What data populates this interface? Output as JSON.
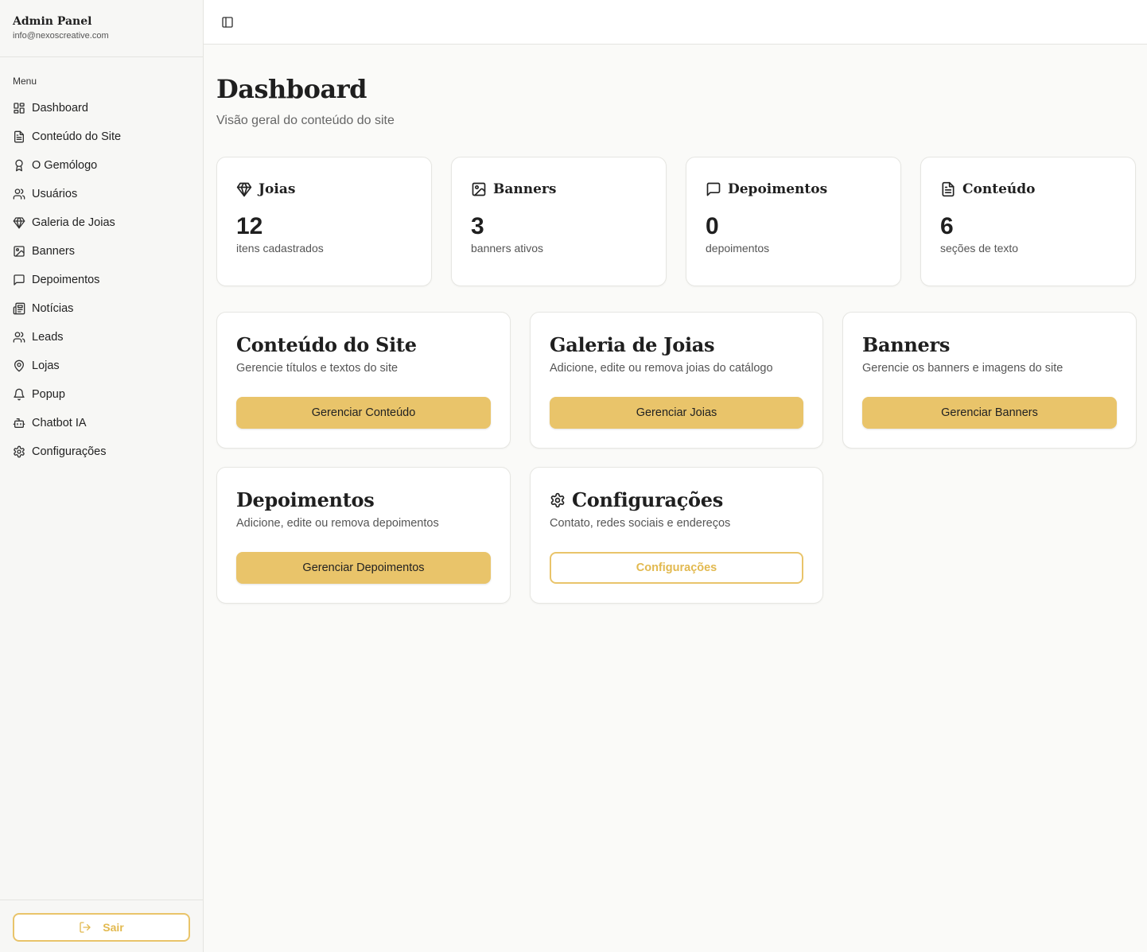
{
  "sidebar": {
    "title": "Admin Panel",
    "email": "info@nexoscreative.com",
    "menu_label": "Menu",
    "items": [
      {
        "label": "Dashboard",
        "icon": "layout-dashboard-icon"
      },
      {
        "label": "Conteúdo do Site",
        "icon": "file-text-icon"
      },
      {
        "label": "O Gemólogo",
        "icon": "award-icon"
      },
      {
        "label": "Usuários",
        "icon": "users-icon"
      },
      {
        "label": "Galeria de Joias",
        "icon": "gem-icon"
      },
      {
        "label": "Banners",
        "icon": "image-icon"
      },
      {
        "label": "Depoimentos",
        "icon": "message-square-icon"
      },
      {
        "label": "Notícias",
        "icon": "newspaper-icon"
      },
      {
        "label": "Leads",
        "icon": "users-icon"
      },
      {
        "label": "Lojas",
        "icon": "map-pin-icon"
      },
      {
        "label": "Popup",
        "icon": "bell-icon"
      },
      {
        "label": "Chatbot IA",
        "icon": "bot-icon"
      },
      {
        "label": "Configurações",
        "icon": "settings-icon"
      }
    ],
    "logout_label": "Sair"
  },
  "main": {
    "title": "Dashboard",
    "subtitle": "Visão geral do conteúdo do site",
    "stats": [
      {
        "label": "Joias",
        "value": "12",
        "desc": "itens cadastrados",
        "icon": "gem-icon"
      },
      {
        "label": "Banners",
        "value": "3",
        "desc": "banners ativos",
        "icon": "image-icon"
      },
      {
        "label": "Depoimentos",
        "value": "0",
        "desc": "depoimentos",
        "icon": "message-square-icon"
      },
      {
        "label": "Conteúdo",
        "value": "6",
        "desc": "seções de texto",
        "icon": "file-text-icon"
      }
    ],
    "actions": [
      {
        "title": "Conteúdo do Site",
        "desc": "Gerencie títulos e textos do site",
        "button": "Gerenciar Conteúdo"
      },
      {
        "title": "Galeria de Joias",
        "desc": "Adicione, edite ou remova joias do catálogo",
        "button": "Gerenciar Joias"
      },
      {
        "title": "Banners",
        "desc": "Gerencie os banners e imagens do site",
        "button": "Gerenciar Banners"
      },
      {
        "title": "Depoimentos",
        "desc": "Adicione, edite ou remova depoimentos",
        "button": "Gerenciar Depoimentos"
      },
      {
        "title": "Configurações",
        "desc": "Contato, redes sociais e endereços",
        "button": "Configurações",
        "icon": "settings-icon"
      }
    ]
  },
  "colors": {
    "accent": "#e9c46a",
    "accent_text": "#e2b94f",
    "background": "#fafaf8",
    "card": "#ffffff"
  }
}
